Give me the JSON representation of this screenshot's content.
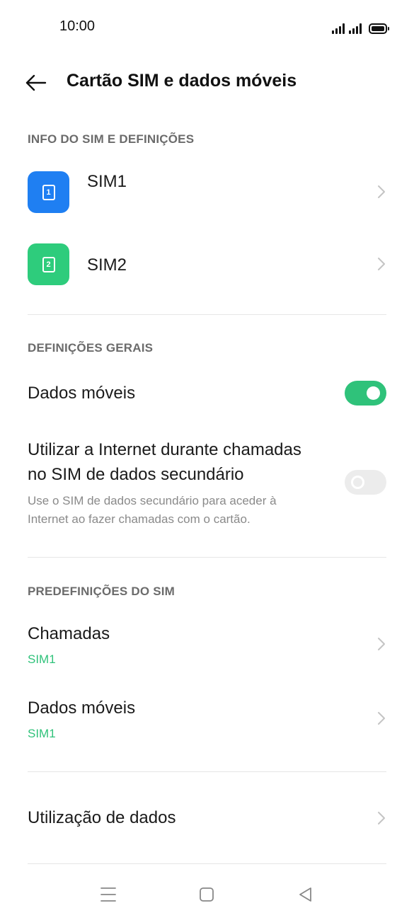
{
  "status_bar": {
    "time": "10:00"
  },
  "header": {
    "title": "Cartão SIM e dados móveis"
  },
  "sections": {
    "sim_info": "INFO DO SIM E DEFINIÇÕES",
    "general": "DEFINIÇÕES GERAIS",
    "defaults": "PREDEFINIÇÕES DO SIM"
  },
  "sims": [
    {
      "label": "SIM1",
      "number": "1",
      "color": "#1f7ff2"
    },
    {
      "label": "SIM2",
      "number": "2",
      "color": "#2ecc7c"
    }
  ],
  "general": {
    "mobile_data_label": "Dados móveis",
    "mobile_data_on": true,
    "secondary_title_line1": "Utilizar a Internet durante chamadas",
    "secondary_title_line2": "no SIM de dados secundário",
    "secondary_desc_line1": "Use o SIM de dados secundário para aceder à",
    "secondary_desc_line2": "Internet ao fazer chamadas com o cartão.",
    "secondary_on": false
  },
  "defaults": {
    "calls_label": "Chamadas",
    "calls_value": "SIM1",
    "data_label": "Dados móveis",
    "data_value": "SIM1"
  },
  "data_usage": {
    "label": "Utilização de dados"
  },
  "colors": {
    "accent": "#2fc27a",
    "sim1": "#1f7ff2",
    "sim2": "#2ecc7c"
  }
}
